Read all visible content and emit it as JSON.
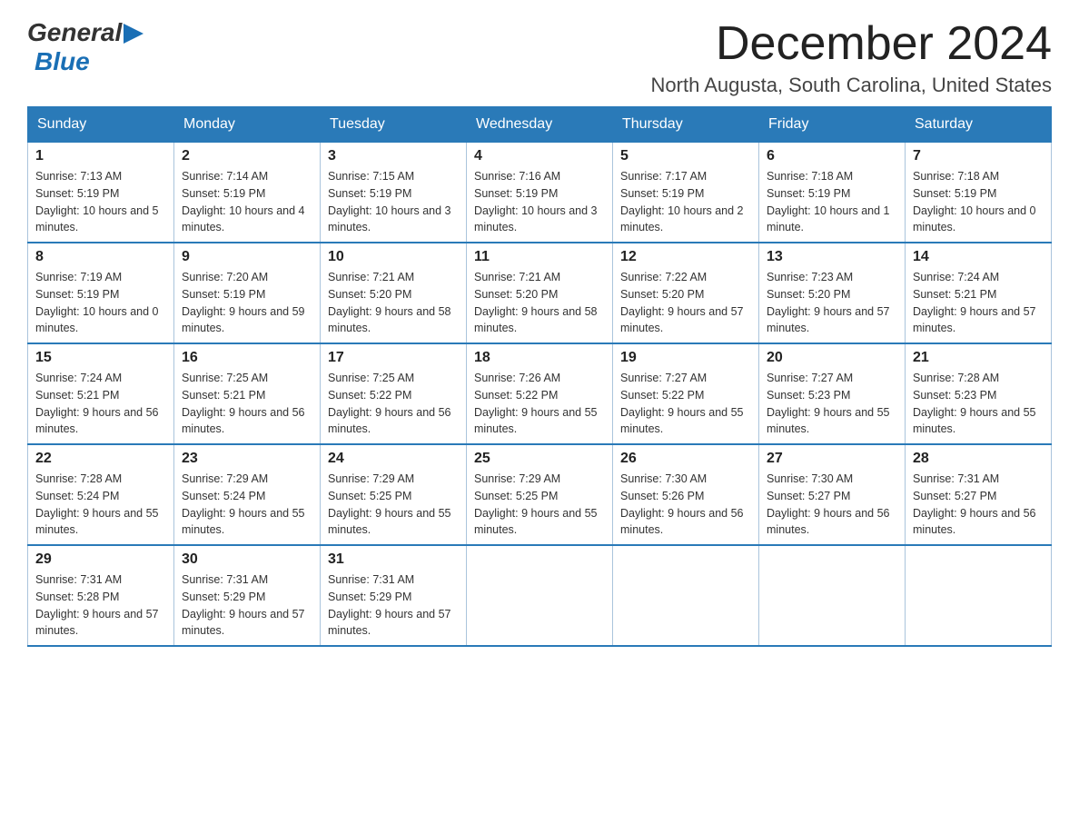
{
  "header": {
    "logo_general": "General",
    "logo_blue": "Blue",
    "month_title": "December 2024",
    "location": "North Augusta, South Carolina, United States"
  },
  "weekdays": [
    "Sunday",
    "Monday",
    "Tuesday",
    "Wednesday",
    "Thursday",
    "Friday",
    "Saturday"
  ],
  "weeks": [
    [
      {
        "day": "1",
        "sunrise": "7:13 AM",
        "sunset": "5:19 PM",
        "daylight": "10 hours and 5 minutes."
      },
      {
        "day": "2",
        "sunrise": "7:14 AM",
        "sunset": "5:19 PM",
        "daylight": "10 hours and 4 minutes."
      },
      {
        "day": "3",
        "sunrise": "7:15 AM",
        "sunset": "5:19 PM",
        "daylight": "10 hours and 3 minutes."
      },
      {
        "day": "4",
        "sunrise": "7:16 AM",
        "sunset": "5:19 PM",
        "daylight": "10 hours and 3 minutes."
      },
      {
        "day": "5",
        "sunrise": "7:17 AM",
        "sunset": "5:19 PM",
        "daylight": "10 hours and 2 minutes."
      },
      {
        "day": "6",
        "sunrise": "7:18 AM",
        "sunset": "5:19 PM",
        "daylight": "10 hours and 1 minute."
      },
      {
        "day": "7",
        "sunrise": "7:18 AM",
        "sunset": "5:19 PM",
        "daylight": "10 hours and 0 minutes."
      }
    ],
    [
      {
        "day": "8",
        "sunrise": "7:19 AM",
        "sunset": "5:19 PM",
        "daylight": "10 hours and 0 minutes."
      },
      {
        "day": "9",
        "sunrise": "7:20 AM",
        "sunset": "5:19 PM",
        "daylight": "9 hours and 59 minutes."
      },
      {
        "day": "10",
        "sunrise": "7:21 AM",
        "sunset": "5:20 PM",
        "daylight": "9 hours and 58 minutes."
      },
      {
        "day": "11",
        "sunrise": "7:21 AM",
        "sunset": "5:20 PM",
        "daylight": "9 hours and 58 minutes."
      },
      {
        "day": "12",
        "sunrise": "7:22 AM",
        "sunset": "5:20 PM",
        "daylight": "9 hours and 57 minutes."
      },
      {
        "day": "13",
        "sunrise": "7:23 AM",
        "sunset": "5:20 PM",
        "daylight": "9 hours and 57 minutes."
      },
      {
        "day": "14",
        "sunrise": "7:24 AM",
        "sunset": "5:21 PM",
        "daylight": "9 hours and 57 minutes."
      }
    ],
    [
      {
        "day": "15",
        "sunrise": "7:24 AM",
        "sunset": "5:21 PM",
        "daylight": "9 hours and 56 minutes."
      },
      {
        "day": "16",
        "sunrise": "7:25 AM",
        "sunset": "5:21 PM",
        "daylight": "9 hours and 56 minutes."
      },
      {
        "day": "17",
        "sunrise": "7:25 AM",
        "sunset": "5:22 PM",
        "daylight": "9 hours and 56 minutes."
      },
      {
        "day": "18",
        "sunrise": "7:26 AM",
        "sunset": "5:22 PM",
        "daylight": "9 hours and 55 minutes."
      },
      {
        "day": "19",
        "sunrise": "7:27 AM",
        "sunset": "5:22 PM",
        "daylight": "9 hours and 55 minutes."
      },
      {
        "day": "20",
        "sunrise": "7:27 AM",
        "sunset": "5:23 PM",
        "daylight": "9 hours and 55 minutes."
      },
      {
        "day": "21",
        "sunrise": "7:28 AM",
        "sunset": "5:23 PM",
        "daylight": "9 hours and 55 minutes."
      }
    ],
    [
      {
        "day": "22",
        "sunrise": "7:28 AM",
        "sunset": "5:24 PM",
        "daylight": "9 hours and 55 minutes."
      },
      {
        "day": "23",
        "sunrise": "7:29 AM",
        "sunset": "5:24 PM",
        "daylight": "9 hours and 55 minutes."
      },
      {
        "day": "24",
        "sunrise": "7:29 AM",
        "sunset": "5:25 PM",
        "daylight": "9 hours and 55 minutes."
      },
      {
        "day": "25",
        "sunrise": "7:29 AM",
        "sunset": "5:25 PM",
        "daylight": "9 hours and 55 minutes."
      },
      {
        "day": "26",
        "sunrise": "7:30 AM",
        "sunset": "5:26 PM",
        "daylight": "9 hours and 56 minutes."
      },
      {
        "day": "27",
        "sunrise": "7:30 AM",
        "sunset": "5:27 PM",
        "daylight": "9 hours and 56 minutes."
      },
      {
        "day": "28",
        "sunrise": "7:31 AM",
        "sunset": "5:27 PM",
        "daylight": "9 hours and 56 minutes."
      }
    ],
    [
      {
        "day": "29",
        "sunrise": "7:31 AM",
        "sunset": "5:28 PM",
        "daylight": "9 hours and 57 minutes."
      },
      {
        "day": "30",
        "sunrise": "7:31 AM",
        "sunset": "5:29 PM",
        "daylight": "9 hours and 57 minutes."
      },
      {
        "day": "31",
        "sunrise": "7:31 AM",
        "sunset": "5:29 PM",
        "daylight": "9 hours and 57 minutes."
      },
      null,
      null,
      null,
      null
    ]
  ]
}
